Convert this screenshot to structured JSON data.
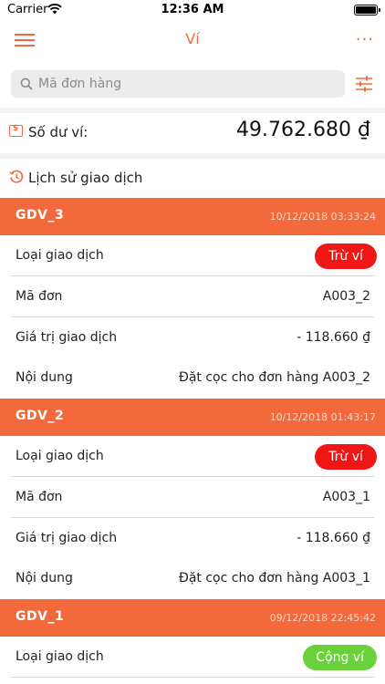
{
  "status_bar": {
    "carrier": "Carrier",
    "time": "12:36 AM"
  },
  "nav": {
    "title": "Ví",
    "more": "..."
  },
  "search": {
    "placeholder": "Mã đơn hàng",
    "value": ""
  },
  "balance": {
    "label": "Số dư ví:",
    "value": "49.762.680 ₫"
  },
  "history": {
    "label": "Lịch sử giao dịch"
  },
  "field_labels": {
    "type": "Loại giao dịch",
    "order": "Mã đơn",
    "amount": "Giá trị giao dịch",
    "content": "Nội dung"
  },
  "transactions": [
    {
      "code": "GDV_3",
      "date": "10/12/2018 03:33:24",
      "type": "Trừ ví",
      "order": "A003_2",
      "amount": "- 118.660 ₫",
      "content": "Đặt cọc cho đơn hàng A003_2"
    },
    {
      "code": "GDV_2",
      "date": "10/12/2018 01:43:17",
      "type": "Trừ ví",
      "order": "A003_1",
      "amount": "- 118.660 ₫",
      "content": "Đặt cọc cho đơn hàng A003_1"
    },
    {
      "code": "GDV_1",
      "date": "09/12/2018 22:45:42",
      "type": "Cộng ví"
    }
  ],
  "colors": {
    "accent": "#f26a3c",
    "debit": "#f01616",
    "credit": "#6ad13a"
  }
}
